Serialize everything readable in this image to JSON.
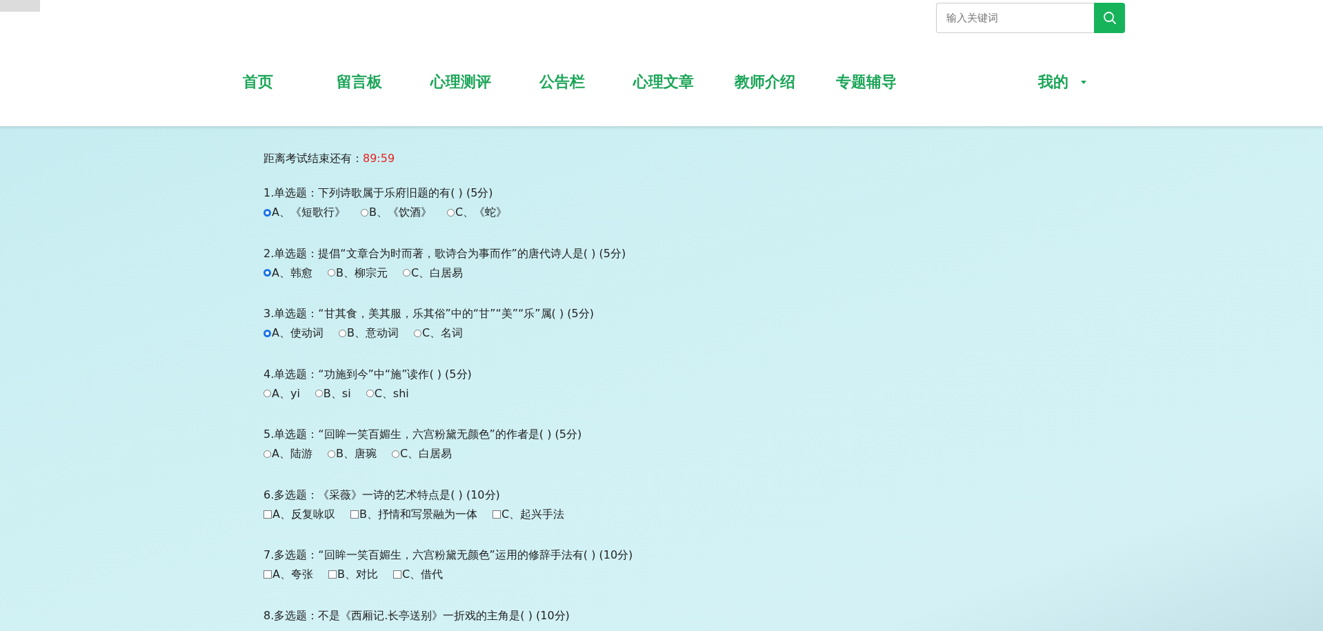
{
  "search": {
    "placeholder": "输入关键词"
  },
  "nav": [
    {
      "label": "首页"
    },
    {
      "label": "留言板"
    },
    {
      "label": "心理测评"
    },
    {
      "label": "公告栏"
    },
    {
      "label": "心理文章"
    },
    {
      "label": "教师介绍"
    },
    {
      "label": "专题辅导"
    }
  ],
  "user_menu": {
    "label": "我的"
  },
  "timer": {
    "label": "距离考试结束还有：",
    "value": "89:59"
  },
  "questions": [
    {
      "kind": "single",
      "title": "1.单选题：下列诗歌属于乐府旧题的有( ) (5分)",
      "options": [
        {
          "label": "A、《短歌行》",
          "selected": true
        },
        {
          "label": "B、《饮酒》",
          "selected": false
        },
        {
          "label": "C、《蛇》",
          "selected": false
        }
      ]
    },
    {
      "kind": "single",
      "title": "2.单选题：提倡“文章合为时而著，歌诗合为事而作”的唐代诗人是( ) (5分)",
      "options": [
        {
          "label": "A、韩愈",
          "selected": true
        },
        {
          "label": "B、柳宗元",
          "selected": false
        },
        {
          "label": "C、白居易",
          "selected": false
        }
      ]
    },
    {
      "kind": "single",
      "title": "3.单选题：“甘其食，美其服，乐其俗”中的“甘”“美”“乐”属( ) (5分)",
      "options": [
        {
          "label": "A、使动词",
          "selected": true
        },
        {
          "label": "B、意动词",
          "selected": false
        },
        {
          "label": "C、名词",
          "selected": false
        }
      ]
    },
    {
      "kind": "single",
      "title": "4.单选题：“功施到今”中“施”读作( ) (5分)",
      "options": [
        {
          "label": "A、yi",
          "selected": false
        },
        {
          "label": "B、si",
          "selected": false
        },
        {
          "label": "C、shi",
          "selected": false
        }
      ]
    },
    {
      "kind": "single",
      "title": "5.单选题：“回眸一笑百媚生，六宫粉黛无颜色”的作者是( ) (5分)",
      "options": [
        {
          "label": "A、陆游",
          "selected": false
        },
        {
          "label": "B、唐琬",
          "selected": false
        },
        {
          "label": "C、白居易",
          "selected": false
        }
      ]
    },
    {
      "kind": "multi",
      "title": "6.多选题：《采薇》一诗的艺术特点是( ) (10分)",
      "options": [
        {
          "label": "A、反复咏叹",
          "selected": false
        },
        {
          "label": "B、抒情和写景融为一体",
          "selected": false
        },
        {
          "label": "C、起兴手法",
          "selected": false
        }
      ]
    },
    {
      "kind": "multi",
      "title": "7.多选题：“回眸一笑百媚生，六宫粉黛无颜色”运用的修辞手法有( ) (10分)",
      "options": [
        {
          "label": "A、夸张",
          "selected": false
        },
        {
          "label": "B、对比",
          "selected": false
        },
        {
          "label": "C、借代",
          "selected": false
        }
      ]
    },
    {
      "title": "8.多选题：不是《西厢记.长亭送别》一折戏的主角是( ) (10分)"
    }
  ]
}
